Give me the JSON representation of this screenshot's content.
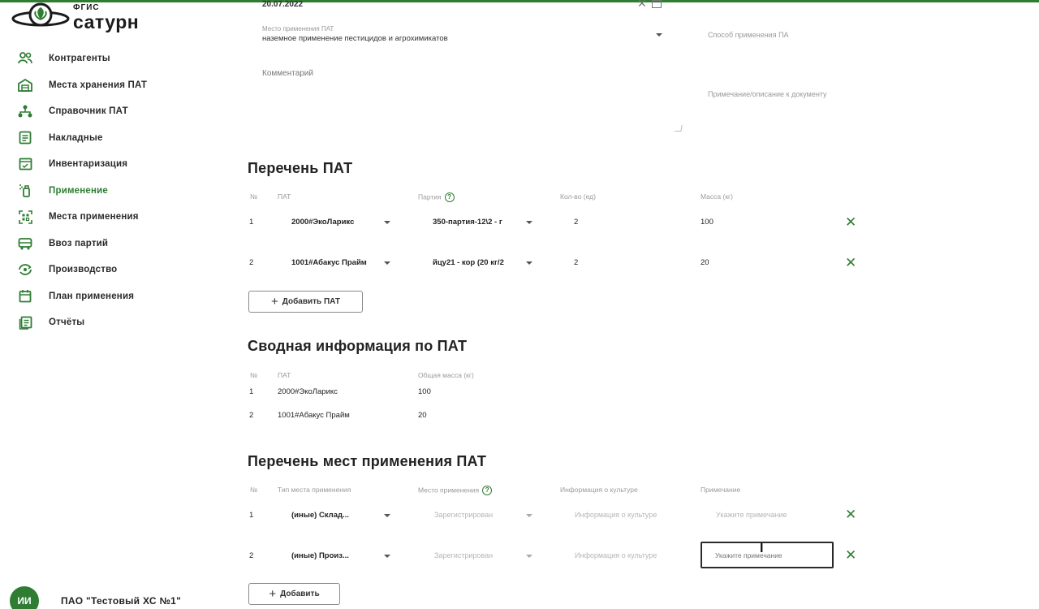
{
  "app": {
    "logo_small": "ФГИС",
    "logo_big": "сатурн"
  },
  "sidebar": {
    "items": [
      {
        "label": "Контрагенты",
        "icon": "users-icon",
        "active": false
      },
      {
        "label": "Места хранения ПАТ",
        "icon": "warehouse-icon",
        "active": false
      },
      {
        "label": "Справочник ПАТ",
        "icon": "hierarchy-icon",
        "active": false
      },
      {
        "label": "Накладные",
        "icon": "document-icon",
        "active": false
      },
      {
        "label": "Инвентаризация",
        "icon": "inventory-icon",
        "active": false
      },
      {
        "label": "Применение",
        "icon": "spray-bottle-icon",
        "active": true
      },
      {
        "label": "Места применения",
        "icon": "qr-code-icon",
        "active": false
      },
      {
        "label": "Ввоз партий",
        "icon": "truck-icon",
        "active": false
      },
      {
        "label": "Производство",
        "icon": "factory-icon",
        "active": false
      },
      {
        "label": "План применения",
        "icon": "calendar-icon",
        "active": false
      },
      {
        "label": "Отчёты",
        "icon": "report-icon",
        "active": false
      }
    ],
    "org": {
      "avatar_initials": "ИИ",
      "name": "ПАО \"Тестовый ХС №1\""
    }
  },
  "form": {
    "date_value": "20.07.2022",
    "place_label": "Место применения ПАТ",
    "place_value": "наземное применение пестицидов и агрохимикатов",
    "method_label": "Способ применения ПА",
    "comment_label": "Комментарий",
    "doc_label": "Примечание/описание к документу"
  },
  "pat_list": {
    "title": "Перечень ПАТ",
    "columns": [
      "№",
      "ПАТ",
      "Партия",
      "Кол-во (ед)",
      "Масса (кг)"
    ],
    "rows": [
      {
        "num": "1",
        "pat": "2000#ЭкоЛарикс",
        "batch": "350-партия-12\\2 - г",
        "qty": "2",
        "mass": "100"
      },
      {
        "num": "2",
        "pat": "1001#Абакус Прайм",
        "batch": "йцу21 - кор (20 кг/2",
        "qty": "2",
        "mass": "20"
      }
    ],
    "add_button": "Добавить ПАТ"
  },
  "summary": {
    "title": "Сводная информация по ПАТ",
    "columns": [
      "№",
      "ПАТ",
      "Общая масса (кг)"
    ],
    "rows": [
      {
        "num": "1",
        "pat": "2000#ЭкоЛарикс",
        "mass": "100"
      },
      {
        "num": "2",
        "pat": "1001#Абакус Прайм",
        "mass": "20"
      }
    ]
  },
  "places": {
    "title": "Перечень мест применения ПАТ",
    "columns": [
      "№",
      "Тип места применения",
      "Место применения",
      "Информация о культуре",
      "Примечание"
    ],
    "rows": [
      {
        "num": "1",
        "type": "(иные) Склад...",
        "place": "Зарегистрирован",
        "culture": "Информация о культуре",
        "note_placeholder": "Укажите примечание"
      },
      {
        "num": "2",
        "type": "(иные) Произ...",
        "place": "Зарегистрирован",
        "culture": "Информация о культуре",
        "note_placeholder": "Укажите примечание"
      }
    ],
    "add_button": "Добавить"
  },
  "colors": {
    "accent": "#2e7d32",
    "text": "#222222",
    "muted": "#9a9a9a"
  }
}
